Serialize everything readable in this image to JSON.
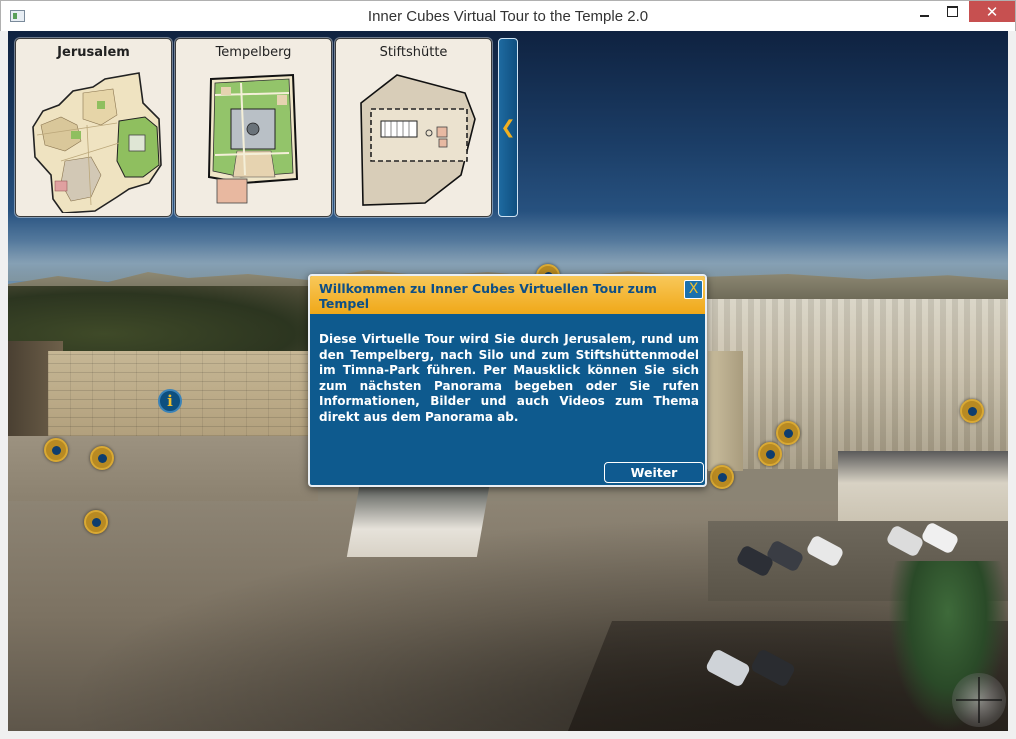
{
  "window": {
    "title": "Inner Cubes Virtual Tour to the Temple 2.0",
    "close_glyph": "✕"
  },
  "maps": [
    {
      "label": "Jerusalem",
      "active": true,
      "icon": "jerusalem-map-icon"
    },
    {
      "label": "Tempelberg",
      "active": false,
      "icon": "temple-mount-map-icon"
    },
    {
      "label": "Stiftshütte",
      "active": false,
      "icon": "tabernacle-map-icon"
    }
  ],
  "map_toggle": {
    "glyph": "❮"
  },
  "info_hotspot": {
    "glyph": "i"
  },
  "dialog": {
    "title": "Willkommen zu Inner Cubes Virtuellen Tour zum Tempel",
    "close_label": "X",
    "body": "Diese Virtuelle Tour wird Sie durch Jerusalem, rund um den Tempelberg, nach Silo und zum Stiftshüttenmodel im Timna-Park führen. Per Mausklick können Sie sich zum nächsten Panorama begeben oder Sie rufen Informationen, Bilder und auch Videos zum Thema direkt aus dem Panorama ab.",
    "next_label": "Weiter"
  },
  "colors": {
    "hotspot": "#b88a22",
    "dialog_bg": "#0e5a8e",
    "dialog_header": "#f0a818",
    "accent": "#f0b020"
  }
}
